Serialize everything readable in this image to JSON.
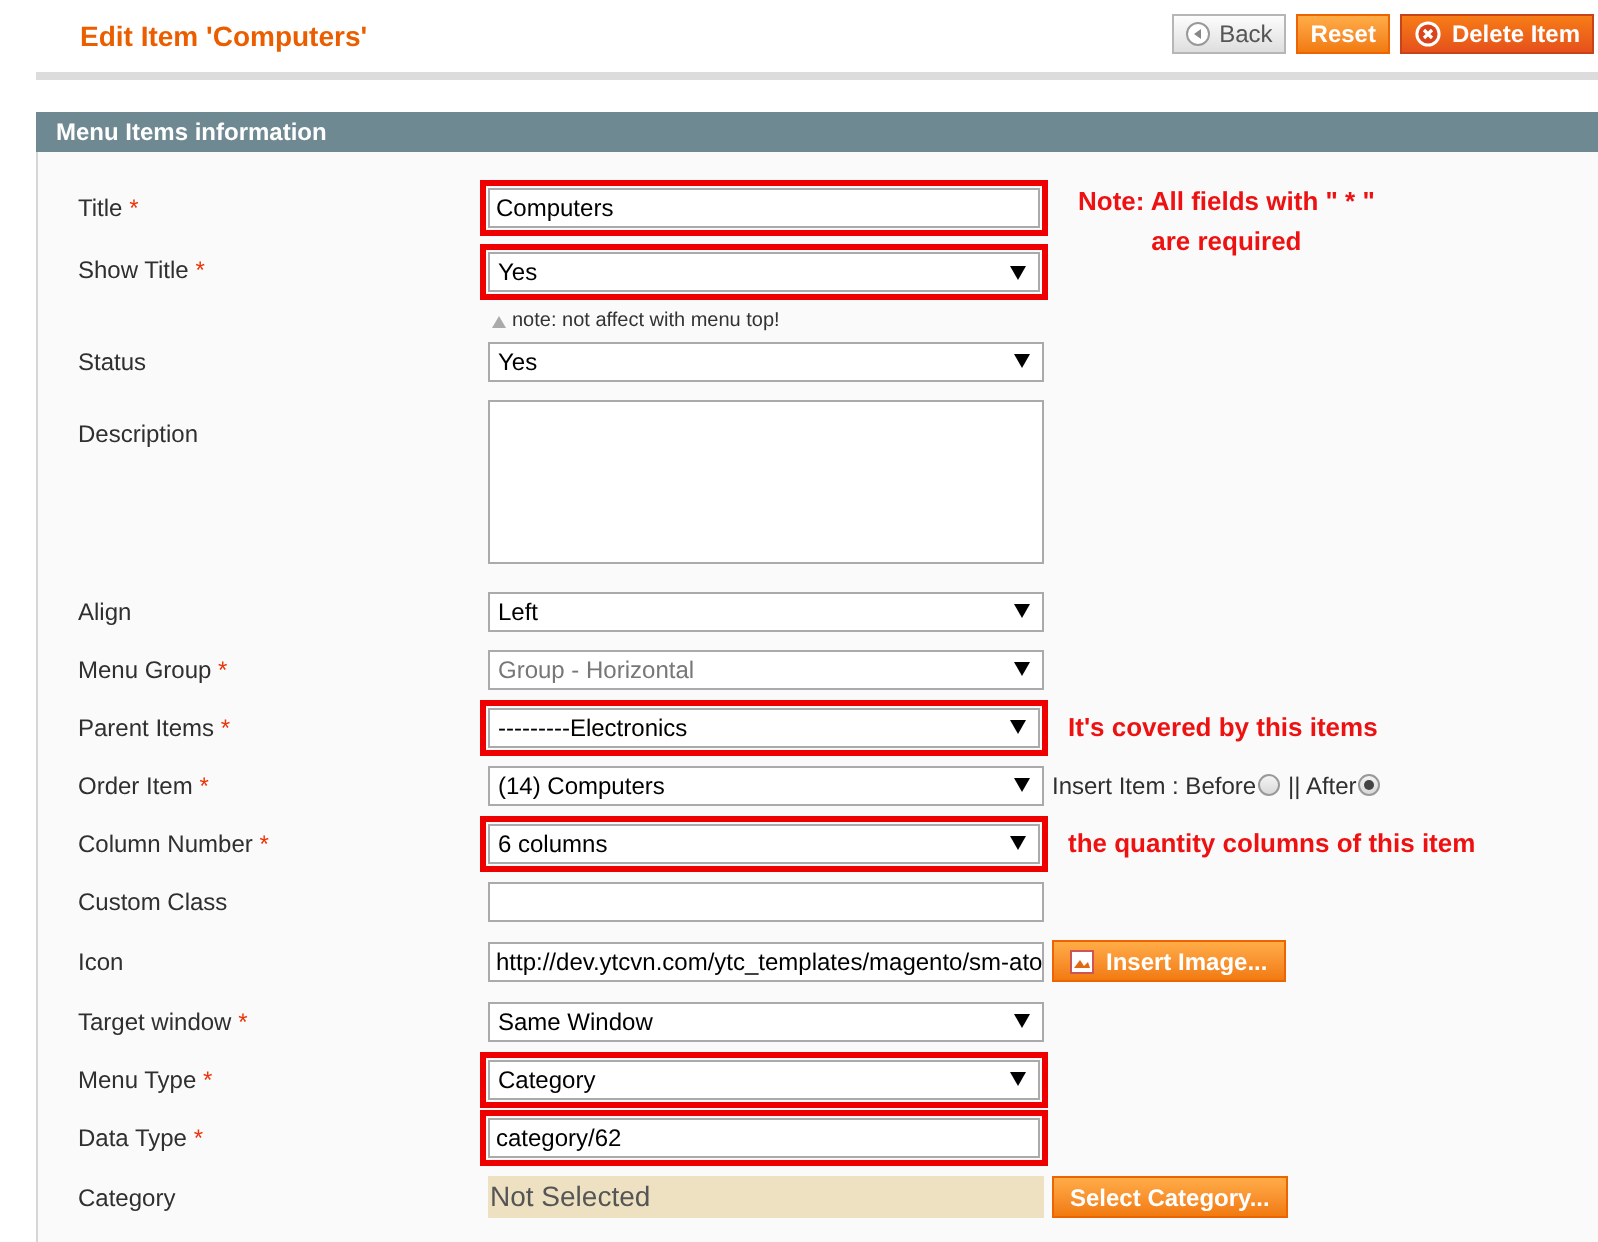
{
  "page_title": "Edit Item 'Computers'",
  "buttons": [
    {
      "label": "Back",
      "kind": "back"
    },
    {
      "label": "Reset",
      "kind": "reset"
    },
    {
      "label": "Delete Item",
      "kind": "delete"
    }
  ],
  "section_title": "Menu Items information",
  "fields": [
    {
      "label": "Title",
      "required_mark": "*",
      "kind": "text",
      "value": "Computers",
      "highlighted": true,
      "annotation": "Note: All fields with \" * \"\nare required"
    },
    {
      "label": "Show Title",
      "required_mark": "*",
      "kind": "select",
      "value": "Yes",
      "highlighted": true,
      "note": "note: not affect with menu top!"
    },
    {
      "label": "Status",
      "kind": "select",
      "value": "Yes",
      "highlighted": false
    },
    {
      "label": "Description",
      "kind": "textarea",
      "highlighted": false
    },
    {
      "label": "Align",
      "kind": "select",
      "value": "Left",
      "highlighted": false
    },
    {
      "label": "Menu Group",
      "required_mark": "*",
      "kind": "select",
      "value": "Group - Horizontal",
      "highlighted": false,
      "disabled": true
    },
    {
      "label": "Parent Items",
      "required_mark": "*",
      "kind": "select",
      "value": "---------Electronics",
      "highlighted": true,
      "annotation": "It's covered by this items"
    },
    {
      "label": "Order Item",
      "required_mark": "*",
      "kind": "select",
      "value": "(14) Computers",
      "highlighted": false,
      "options": [
        {
          "label": "Insert Item : Before",
          "selected": false
        },
        {
          "label": "|| After",
          "selected": true
        }
      ]
    },
    {
      "label": "Column Number",
      "required_mark": "*",
      "kind": "select",
      "value": "6 columns",
      "highlighted": true,
      "annotation": "the quantity columns of this item"
    },
    {
      "label": "Custom Class",
      "kind": "text",
      "highlighted": false
    },
    {
      "label": "Icon",
      "kind": "text",
      "value": "http://dev.ytcvn.com/ytc_templates/magento/sm-ato",
      "highlighted": false,
      "button": "Insert Image..."
    },
    {
      "label": "Target window",
      "required_mark": "*",
      "kind": "select",
      "value": "Same Window",
      "highlighted": false
    },
    {
      "label": "Menu Type",
      "required_mark": "*",
      "kind": "select",
      "value": "Category",
      "highlighted": true
    },
    {
      "label": "Data Type",
      "required_mark": "*",
      "kind": "text",
      "value": "category/62",
      "highlighted": true
    },
    {
      "label": "Category",
      "kind": "chooser",
      "value": "Not Selected",
      "highlighted": false,
      "button": "Select Category..."
    }
  ]
}
